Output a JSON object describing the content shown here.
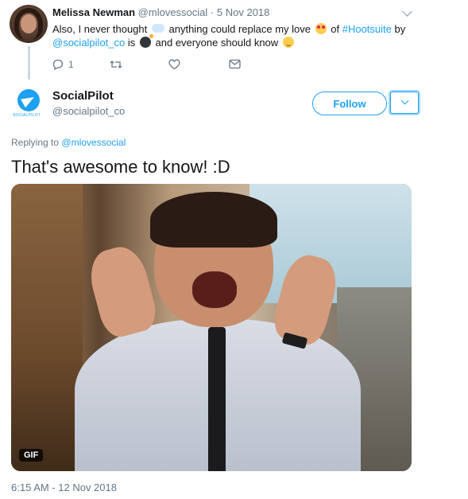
{
  "parent_tweet": {
    "author_name": "Melissa Newman",
    "author_handle": "@mlovessocial",
    "separator": "·",
    "date": "5 Nov 2018",
    "body": {
      "part1": "Also, I never thought",
      "part2": "anything could replace my love",
      "part3": "of",
      "hashtag": "#Hootsuite",
      "part4": "by",
      "mention": "@socialpilot_co",
      "part5": "is",
      "part6": "and everyone should know"
    },
    "emojis": [
      "cloud-emoji",
      "heart-eyes-emoji",
      "bomb-emoji",
      "relieved-emoji"
    ],
    "reply_count": "1"
  },
  "main_tweet": {
    "author_name": "SocialPilot",
    "author_handle": "@socialpilot_co",
    "avatar_brand": "SOCIALPILOT",
    "follow_label": "Follow",
    "replying_prefix": "Replying to",
    "replying_to": "@mlovessocial",
    "text": "That's awesome to know! :D",
    "media_badge": "GIF",
    "timestamp": "6:15 AM - 12 Nov 2018"
  },
  "colors": {
    "accent": "#1da1f2",
    "muted": "#657786",
    "text": "#14171a"
  }
}
